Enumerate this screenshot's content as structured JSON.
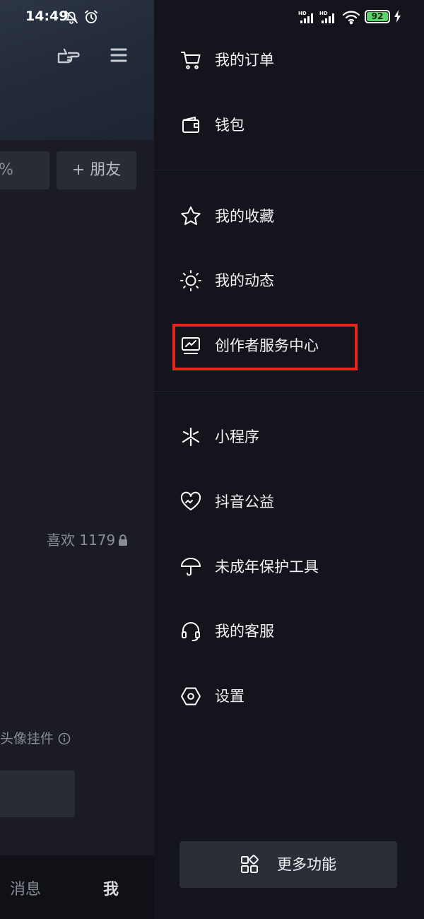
{
  "status_bar": {
    "time": "14:49",
    "battery_level": "92",
    "network_labels": [
      "HD",
      "HD"
    ]
  },
  "left_page": {
    "percent_fragment": "%",
    "add_friend_label": "+ 朋友",
    "likes_label": "喜欢 1179",
    "pendant_label": "头像挂件",
    "tab_messages": "消息",
    "tab_me": "我"
  },
  "drawer": {
    "items": [
      {
        "label": "我的订单",
        "icon": "cart-icon"
      },
      {
        "label": "钱包",
        "icon": "wallet-icon"
      },
      {
        "label": "我的收藏",
        "icon": "star-icon"
      },
      {
        "label": "我的动态",
        "icon": "sun-icon"
      },
      {
        "label": "创作者服务中心",
        "icon": "monitor-chart-icon",
        "highlighted": true
      },
      {
        "label": "小程序",
        "icon": "mini-program-icon"
      },
      {
        "label": "抖音公益",
        "icon": "heart-charity-icon"
      },
      {
        "label": "未成年保护工具",
        "icon": "umbrella-icon"
      },
      {
        "label": "我的客服",
        "icon": "headset-icon"
      },
      {
        "label": "设置",
        "icon": "hex-settings-icon"
      }
    ],
    "more_button_label": "更多功能"
  },
  "colors": {
    "background": "#14151c",
    "highlight": "#e8261f",
    "battery": "#5bd36b"
  }
}
